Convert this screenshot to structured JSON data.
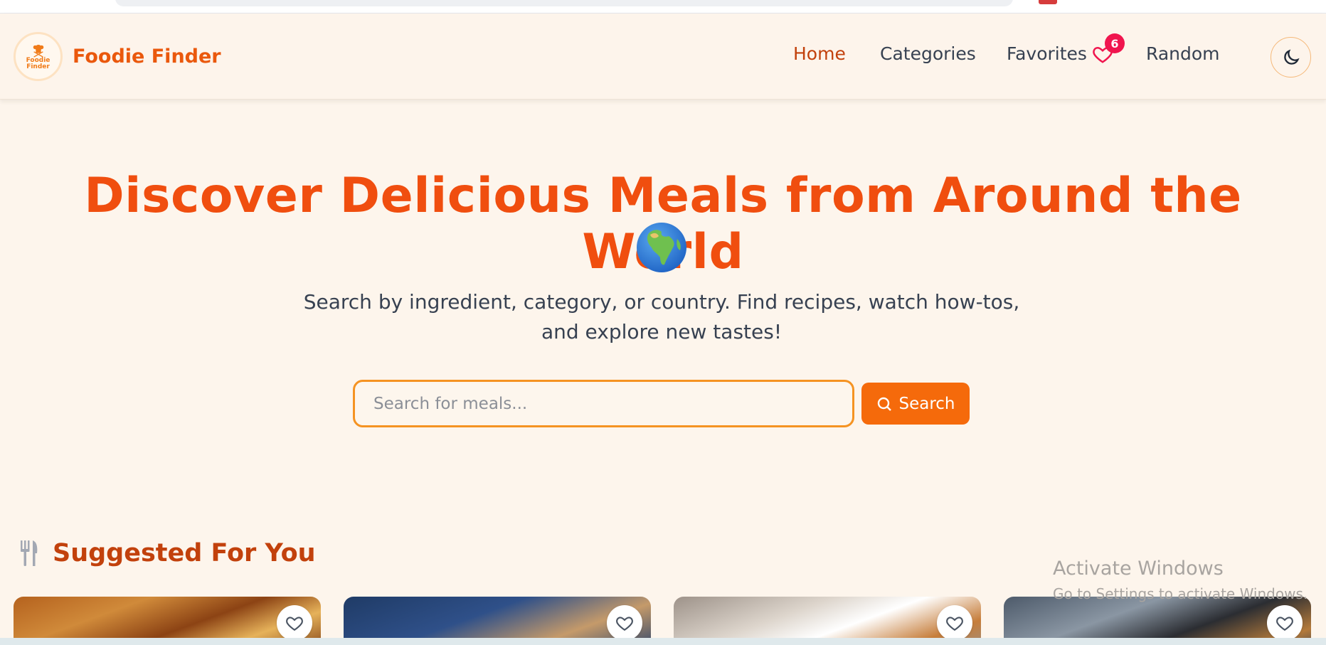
{
  "brand": {
    "name": "Foodie Finder",
    "logo_text": "Foodie Finder"
  },
  "nav": {
    "home": "Home",
    "categories": "Categories",
    "favorites": "Favorites",
    "favorites_count": "6",
    "random": "Random",
    "theme_icon": "moon-icon"
  },
  "hero": {
    "title": "Discover Delicious Meals from Around the World",
    "emoji": "globe-africa-icon",
    "subtitle": "Search by ingredient, category, or country. Find recipes, watch how-tos, and explore new tastes!"
  },
  "search": {
    "placeholder": "Search for meals...",
    "button_label": "Search"
  },
  "suggested": {
    "title": "Suggested For You",
    "icon": "utensils-icon",
    "cards": [
      {
        "favorite_icon": "heart-icon"
      },
      {
        "favorite_icon": "heart-icon"
      },
      {
        "favorite_icon": "heart-icon"
      },
      {
        "favorite_icon": "heart-icon"
      }
    ]
  },
  "watermark": {
    "line1": "Activate Windows",
    "line2": "Go to Settings to activate Windows."
  },
  "colors": {
    "accent": "#ea580c",
    "badge": "#f0154e",
    "background": "#fdf5ec",
    "button": "#f56a0b"
  }
}
